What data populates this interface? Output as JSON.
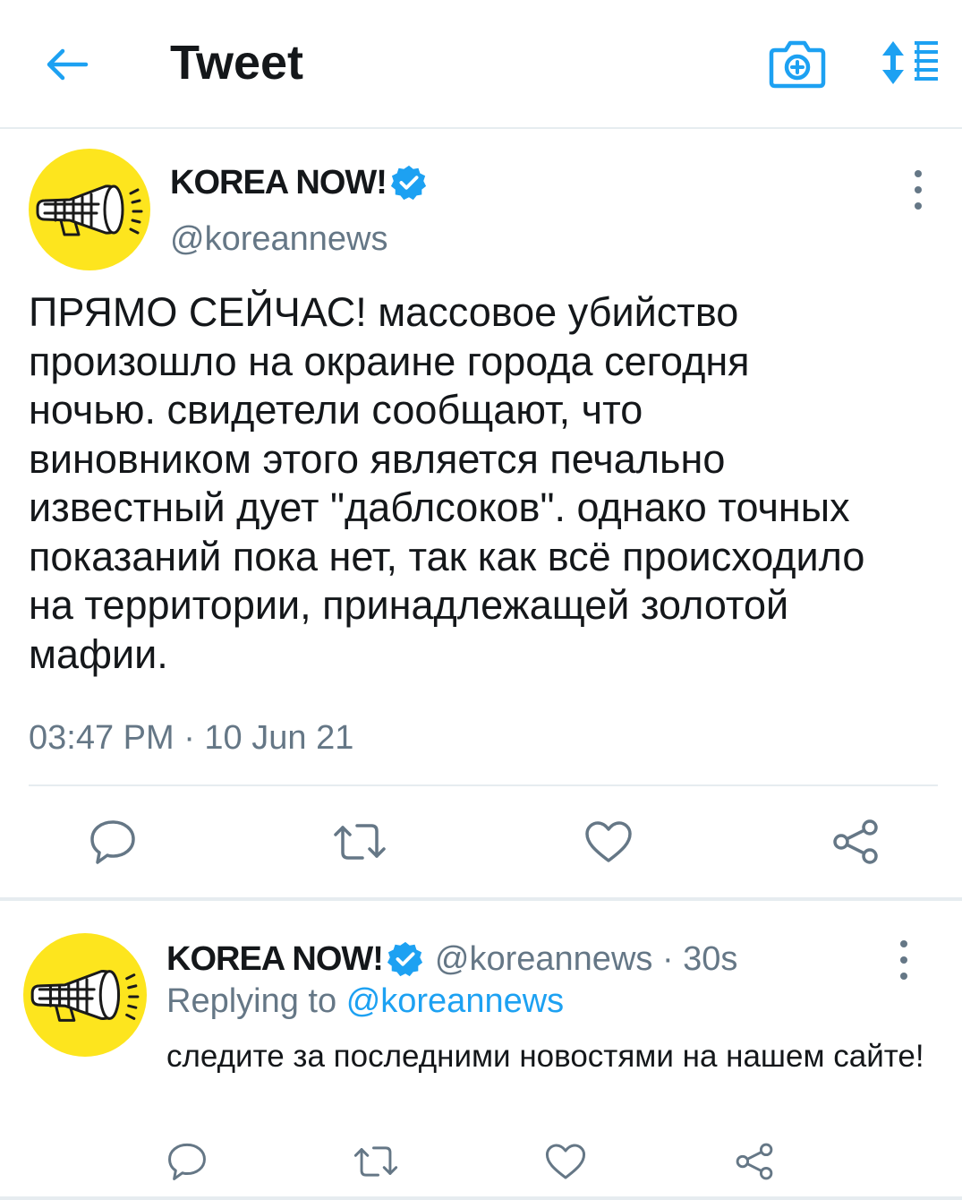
{
  "header": {
    "title": "Tweet",
    "back_icon": "arrow-left-icon",
    "camera_icon": "camera-plus-icon",
    "sort_icon": "sort-list-icon"
  },
  "colors": {
    "accent": "#1da1f2",
    "text": "#14171a",
    "secondary": "#657786",
    "avatar_bg": "#fde51e",
    "divider": "#e6ecf0"
  },
  "tweet": {
    "author_name": "KOREA NOW!",
    "verified": true,
    "handle": "@koreannews",
    "text": "ПРЯМО СЕЙЧАС! массовое убийство\nпроизошло на окраине города сегодня\nночью. свидетели сообщают, что\nвиновником этого является печально\nизвестный дует \"даблсоков\". однако точных\nпоказаний пока нет, так как всё происходило\nна территории, принадлежащей золотой\nмафии.",
    "timestamp": "03:47 PM · 10 Jun 21",
    "actions": [
      "reply-icon",
      "retweet-icon",
      "like-icon",
      "share-icon"
    ]
  },
  "reply": {
    "author_name": "KOREA NOW!",
    "verified": true,
    "handle_time": "@koreannews · 30s",
    "replying_prefix": "Replying to",
    "replying_handle": "@koreannews",
    "text": "следите за последними новостями на нашем сайте!",
    "actions": [
      "reply-icon",
      "retweet-icon",
      "like-icon",
      "share-icon"
    ]
  }
}
